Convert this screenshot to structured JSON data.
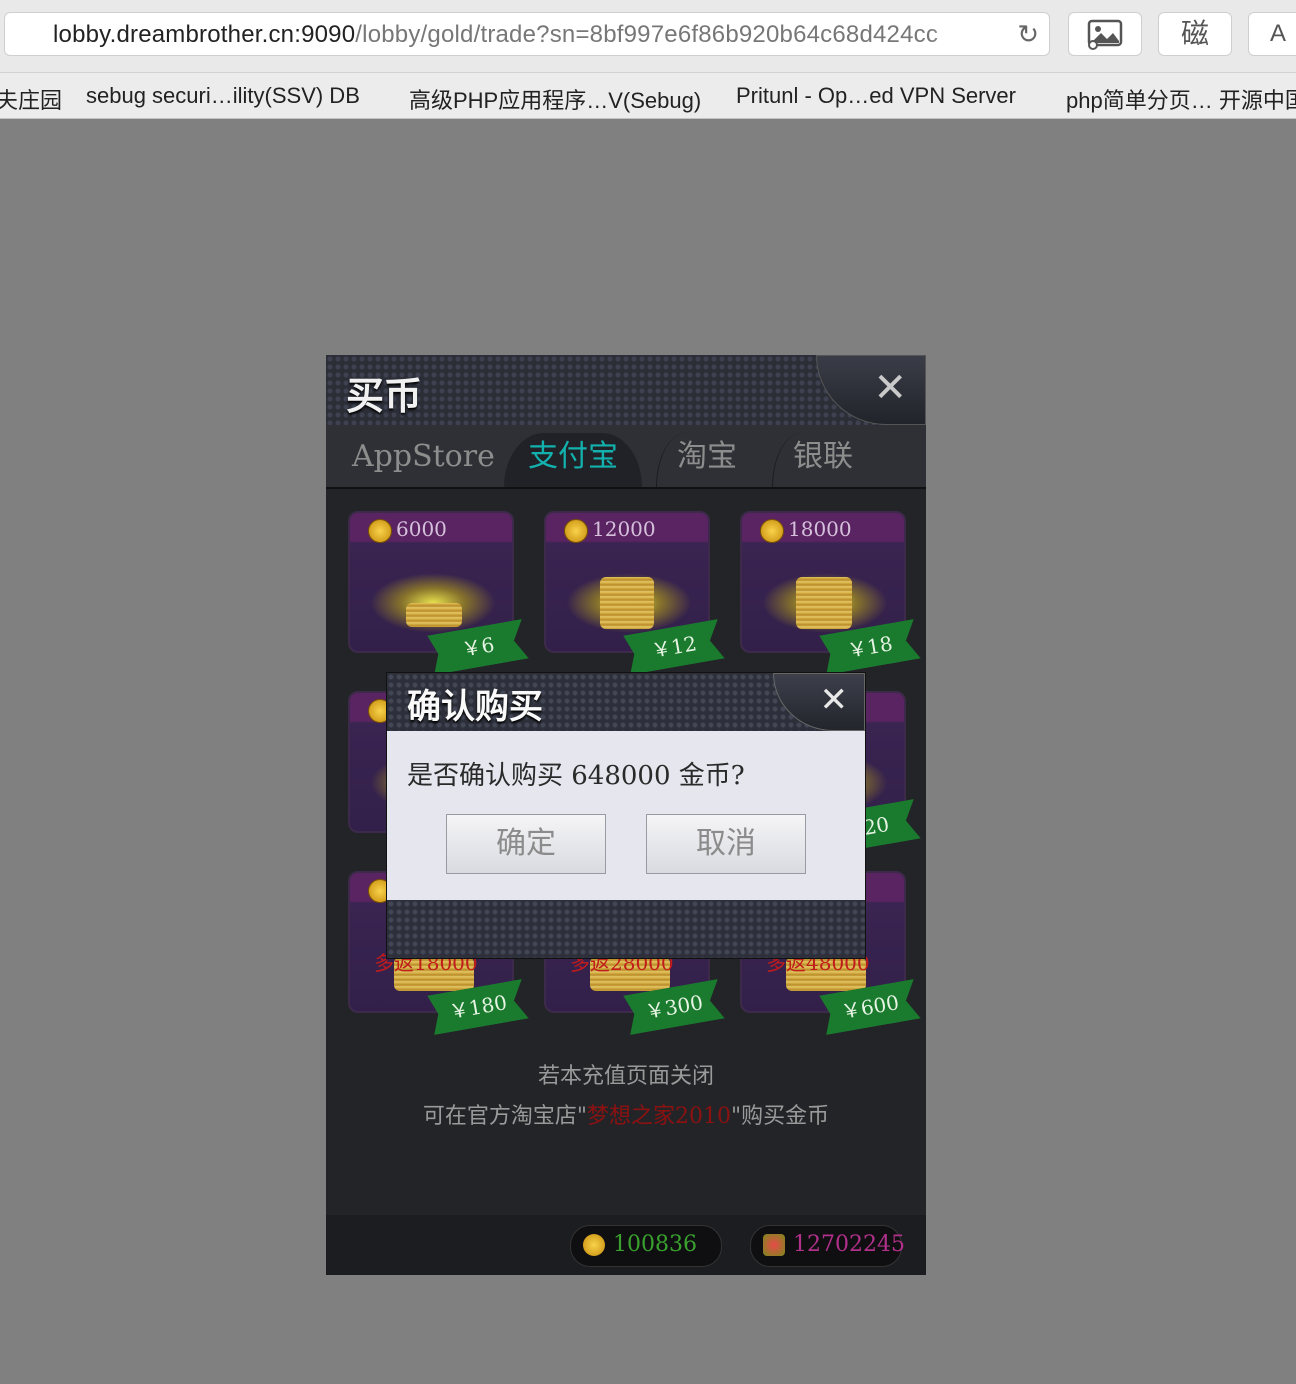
{
  "browser": {
    "url_host": "lobby.dreambrother.cn:9090",
    "url_path": "/lobby/gold/trade?sn=8bf997e6f86b920b64c68d424cc",
    "ext_button_2": "磁",
    "ext_button_3": "A",
    "bookmarks": [
      "夫庄园",
      "sebug securi…ility(SSV) DB",
      "高级PHP应用程序…V(Sebug)",
      "Pritunl - Op…ed VPN Server",
      "php简单分页… 开源中国"
    ]
  },
  "panel": {
    "title": "买币",
    "close_glyph": "✕",
    "tabs": [
      "AppStore",
      "支付宝",
      "淘宝",
      "银联"
    ],
    "active_tab": "支付宝",
    "cards": [
      {
        "coins": "6000",
        "price": "￥6",
        "bonus": ""
      },
      {
        "coins": "12000",
        "price": "￥12",
        "bonus": ""
      },
      {
        "coins": "18000",
        "price": "￥18",
        "bonus": ""
      },
      {
        "coins": "",
        "price": "",
        "bonus": ""
      },
      {
        "coins": "",
        "price": "",
        "bonus": ""
      },
      {
        "coins": "",
        "price": "120",
        "bonus": ""
      },
      {
        "coins": "",
        "price": "￥180",
        "bonus": "多返18000"
      },
      {
        "coins": "",
        "price": "￥300",
        "bonus": "多返28000"
      },
      {
        "coins": "",
        "price": "￥600",
        "bonus": "多返48000"
      }
    ],
    "note_line1": "若本充值页面关闭",
    "note_line2_prefix": "可在官方淘宝店\"",
    "note_store": "梦想之家2010",
    "note_line2_suffix": "\"购买金币",
    "gold_balance": "100836",
    "ticket_balance": "12702245"
  },
  "dialog": {
    "title": "确认购买",
    "close_glyph": "✕",
    "message": "是否确认购买 648000 金币?",
    "confirm_label": "确定",
    "cancel_label": "取消"
  },
  "colors": {
    "active_tab": "#12b1ad",
    "gold_text": "#3aa02e",
    "ticket_text": "#b0308a",
    "store_link": "#8c1111"
  }
}
